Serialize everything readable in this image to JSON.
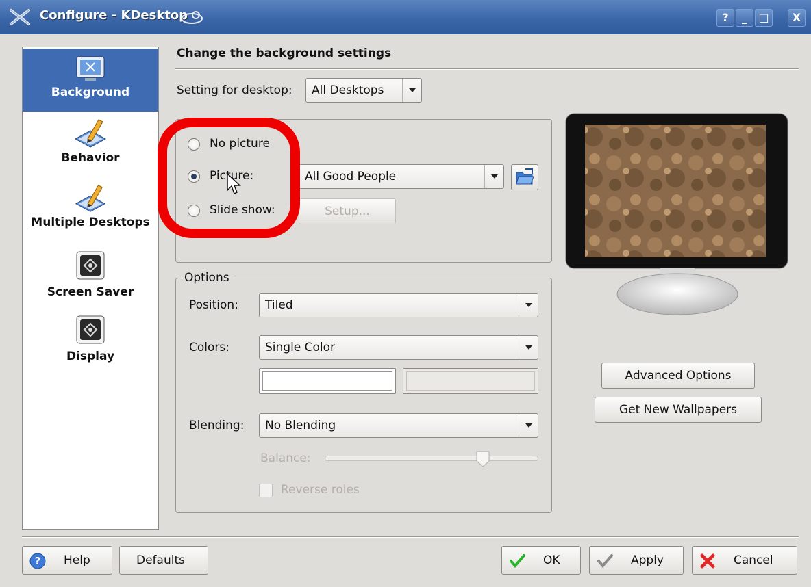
{
  "window": {
    "title": "Configure - KDesktop"
  },
  "titlebar_buttons": [
    "?",
    "_",
    "□",
    "X"
  ],
  "sidebar": {
    "items": [
      {
        "label": "Background",
        "icon": "monitor-icon",
        "active": true
      },
      {
        "label": "Behavior",
        "icon": "pencil-icon"
      },
      {
        "label": "Multiple Desktops",
        "icon": "pencil-icon"
      },
      {
        "label": "Screen Saver",
        "icon": "screensaver-icon"
      },
      {
        "label": "Display",
        "icon": "screensaver-icon"
      }
    ]
  },
  "main": {
    "heading": "Change the background settings",
    "desktop_setting_label": "Setting for desktop:",
    "desktop_setting_value": "All Desktops",
    "picture_group": {
      "no_picture_label": "No picture",
      "picture_label": "Picture:",
      "slide_show_label": "Slide show:",
      "selected": "Picture:",
      "picture_value": "All Good People",
      "setup_label": "Setup..."
    },
    "options": {
      "title": "Options",
      "position_label": "Position:",
      "position_value": "Tiled",
      "colors_label": "Colors:",
      "colors_value": "Single Color",
      "blending_label": "Blending:",
      "blending_value": "No Blending",
      "balance_label": "Balance:",
      "reverse_roles_label": "Reverse roles"
    },
    "advanced_options_label": "Advanced Options",
    "get_new_wallpapers_label": "Get New Wallpapers"
  },
  "footer": {
    "help_label": "Help",
    "defaults_label": "Defaults",
    "ok_label": "OK",
    "apply_label": "Apply",
    "cancel_label": "Cancel"
  },
  "colors": {
    "titlebar": "#3b66a8",
    "sidebar_active": "#3e6bb2",
    "highlight_ring": "#ee0000"
  }
}
